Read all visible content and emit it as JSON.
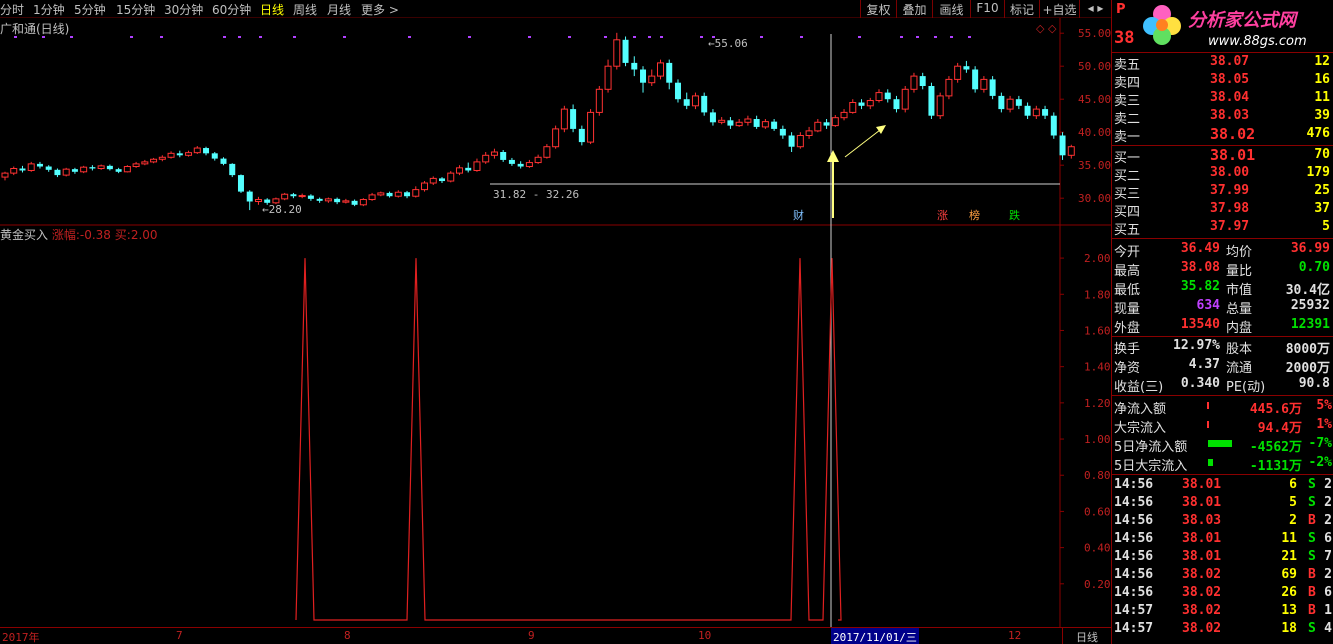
{
  "toolbar": {
    "periods": [
      "分时",
      "1分钟",
      "5分钟",
      "15分钟",
      "30分钟",
      "60分钟",
      "日线",
      "周线",
      "月线",
      "更多 >"
    ],
    "active_period": "日线",
    "right_buttons": [
      "复权",
      "叠加",
      "画线",
      "F10",
      "标记",
      "+自选"
    ]
  },
  "main_pane": {
    "title": "广和通(日线)",
    "annotation_high": "55.06",
    "annotation_low": "28.20",
    "annotation_range": "31.82 - 32.26",
    "markers": [
      {
        "label": "财",
        "color": "#80c0ff"
      },
      {
        "label": "涨",
        "color": "#ff4040"
      },
      {
        "label": "榜",
        "color": "#ffa040"
      },
      {
        "label": "跌",
        "color": "#00e000"
      }
    ],
    "y_ticks": [
      "55.00",
      "50.00",
      "45.00",
      "40.00",
      "35.00",
      "30.00"
    ]
  },
  "indicator_pane": {
    "name": "黄金买入",
    "field1_label": "涨幅:",
    "field1_value": "-0.38",
    "field2_label": "买:",
    "field2_value": "2.00",
    "y_ticks": [
      "2.00",
      "1.80",
      "1.60",
      "1.40",
      "1.20",
      "1.00",
      "0.80",
      "0.60",
      "0.40",
      "0.20"
    ]
  },
  "date_axis": {
    "labels": [
      "2017年",
      "7",
      "8",
      "9",
      "10",
      "12"
    ],
    "highlight": "2017/11/01/三",
    "tab": "日线"
  },
  "quote_panel": {
    "price_big": "38",
    "logo_text": "分析家公式网",
    "logo_url": "www.88gs.com",
    "asks": [
      {
        "label": "卖五",
        "price": "38.07",
        "vol": "12"
      },
      {
        "label": "卖四",
        "price": "38.05",
        "vol": "16"
      },
      {
        "label": "卖三",
        "price": "38.04",
        "vol": "11"
      },
      {
        "label": "卖二",
        "price": "38.03",
        "vol": "39"
      },
      {
        "label": "卖一",
        "price": "38.02",
        "vol": "476"
      }
    ],
    "bids": [
      {
        "label": "买一",
        "price": "38.01",
        "vol": "70"
      },
      {
        "label": "买二",
        "price": "38.00",
        "vol": "179"
      },
      {
        "label": "买三",
        "price": "37.99",
        "vol": "25"
      },
      {
        "label": "买四",
        "price": "37.98",
        "vol": "37"
      },
      {
        "label": "买五",
        "price": "37.97",
        "vol": "5"
      }
    ],
    "stats": [
      {
        "l1": "今开",
        "v1": "36.49",
        "l2": "均价",
        "v2": "36.99"
      },
      {
        "l1": "最高",
        "v1": "38.08",
        "l2": "量比",
        "v2": "0.70"
      },
      {
        "l1": "最低",
        "v1": "35.82",
        "l2": "市值",
        "v2": "30.4亿"
      },
      {
        "l1": "现量",
        "v1": "634",
        "l2": "总量",
        "v2": "25932"
      },
      {
        "l1": "外盘",
        "v1": "13540",
        "l2": "内盘",
        "v2": "12391"
      }
    ],
    "stats2": [
      {
        "l1": "换手",
        "v1": "12.97%",
        "l2": "股本",
        "v2": "8000万"
      },
      {
        "l1": "净资",
        "v1": "4.37",
        "l2": "流通",
        "v2": "2000万"
      },
      {
        "l1": "收益(三)",
        "v1": "0.340",
        "l2": "PE(动)",
        "v2": "90.8"
      }
    ],
    "flows": [
      {
        "label": "净流入额",
        "value": "445.6万",
        "pct": "5%"
      },
      {
        "label": "大宗流入",
        "value": "94.4万",
        "pct": "1%"
      },
      {
        "label": "5日净流入额",
        "value": "-4562万",
        "pct": "-7%"
      },
      {
        "label": "5日大宗流入",
        "value": "-1131万",
        "pct": "-2%"
      }
    ],
    "ticks": [
      {
        "time": "14:56",
        "price": "38.01",
        "vol": "6",
        "side": "S",
        "n": "2"
      },
      {
        "time": "14:56",
        "price": "38.01",
        "vol": "5",
        "side": "S",
        "n": "2"
      },
      {
        "time": "14:56",
        "price": "38.03",
        "vol": "2",
        "side": "B",
        "n": "2"
      },
      {
        "time": "14:56",
        "price": "38.01",
        "vol": "11",
        "side": "S",
        "n": "6"
      },
      {
        "time": "14:56",
        "price": "38.01",
        "vol": "21",
        "side": "S",
        "n": "7"
      },
      {
        "time": "14:56",
        "price": "38.02",
        "vol": "69",
        "side": "B",
        "n": "2"
      },
      {
        "time": "14:56",
        "price": "38.02",
        "vol": "26",
        "side": "B",
        "n": "6"
      },
      {
        "time": "14:57",
        "price": "38.02",
        "vol": "13",
        "side": "B",
        "n": "1"
      },
      {
        "time": "14:57",
        "price": "38.02",
        "vol": "18",
        "side": "S",
        "n": "4"
      }
    ]
  },
  "chart_data": {
    "type": "candlestick",
    "title": "广和通(日线)",
    "ylim": [
      27,
      57
    ],
    "candles": [
      [
        33.2,
        33.8,
        32.7,
        34.0
      ],
      [
        33.8,
        34.5,
        33.5,
        34.8
      ],
      [
        34.5,
        34.2,
        33.9,
        34.9
      ],
      [
        34.2,
        35.2,
        34.0,
        35.5
      ],
      [
        35.2,
        34.8,
        34.5,
        35.5
      ],
      [
        34.8,
        34.3,
        34.0,
        35.0
      ],
      [
        34.3,
        33.5,
        33.2,
        34.5
      ],
      [
        33.5,
        34.4,
        33.3,
        34.6
      ],
      [
        34.4,
        34.0,
        33.7,
        34.6
      ],
      [
        34.0,
        34.7,
        33.8,
        34.9
      ],
      [
        34.7,
        34.5,
        34.2,
        35.0
      ],
      [
        34.5,
        34.9,
        34.3,
        35.1
      ],
      [
        34.9,
        34.4,
        34.2,
        35.1
      ],
      [
        34.4,
        34.0,
        33.8,
        34.6
      ],
      [
        34.0,
        34.8,
        33.9,
        35.0
      ],
      [
        34.8,
        35.2,
        34.6,
        35.5
      ],
      [
        35.2,
        35.5,
        35.0,
        35.8
      ],
      [
        35.5,
        35.9,
        35.3,
        36.1
      ],
      [
        35.9,
        36.2,
        35.6,
        36.5
      ],
      [
        36.2,
        36.8,
        36.0,
        37.1
      ],
      [
        36.8,
        36.5,
        36.2,
        37.2
      ],
      [
        36.5,
        36.9,
        36.3,
        37.2
      ],
      [
        36.9,
        37.6,
        36.7,
        37.9
      ],
      [
        37.6,
        36.8,
        36.5,
        37.8
      ],
      [
        36.8,
        36.0,
        35.7,
        37.0
      ],
      [
        36.0,
        35.2,
        35.0,
        36.2
      ],
      [
        35.2,
        33.5,
        33.2,
        35.3
      ],
      [
        33.5,
        31.0,
        30.8,
        33.6
      ],
      [
        31.0,
        29.5,
        28.2,
        31.2
      ],
      [
        29.5,
        29.8,
        29.0,
        30.2
      ],
      [
        29.8,
        29.3,
        29.0,
        30.0
      ],
      [
        29.3,
        29.9,
        29.1,
        30.1
      ],
      [
        29.9,
        30.6,
        29.7,
        30.8
      ],
      [
        30.6,
        30.3,
        30.0,
        30.8
      ],
      [
        30.3,
        30.4,
        30.0,
        30.7
      ],
      [
        30.4,
        29.9,
        29.6,
        30.6
      ],
      [
        29.9,
        29.6,
        29.3,
        30.1
      ],
      [
        29.6,
        29.9,
        29.3,
        30.1
      ],
      [
        29.9,
        29.4,
        29.1,
        30.1
      ],
      [
        29.4,
        29.6,
        29.2,
        29.9
      ],
      [
        29.6,
        29.0,
        28.8,
        29.8
      ],
      [
        29.0,
        29.8,
        28.8,
        30.0
      ],
      [
        29.8,
        30.5,
        29.6,
        30.8
      ],
      [
        30.5,
        30.8,
        30.3,
        31.0
      ],
      [
        30.8,
        30.3,
        30.1,
        31.0
      ],
      [
        30.3,
        30.9,
        30.1,
        31.2
      ],
      [
        30.9,
        30.3,
        30.0,
        31.1
      ],
      [
        30.3,
        31.3,
        30.1,
        31.8
      ],
      [
        31.3,
        32.3,
        31.0,
        32.6
      ],
      [
        32.3,
        33.0,
        32.0,
        33.3
      ],
      [
        33.0,
        32.6,
        32.3,
        33.2
      ],
      [
        32.6,
        33.8,
        32.4,
        34.1
      ],
      [
        33.8,
        34.6,
        33.5,
        35.0
      ],
      [
        34.6,
        34.2,
        33.9,
        35.4
      ],
      [
        34.2,
        35.5,
        34.0,
        36.0
      ],
      [
        35.5,
        36.5,
        35.2,
        37.0
      ],
      [
        36.5,
        37.0,
        36.0,
        37.5
      ],
      [
        37.0,
        35.8,
        35.5,
        37.3
      ],
      [
        35.8,
        35.2,
        34.9,
        36.1
      ],
      [
        35.2,
        34.8,
        34.5,
        35.6
      ],
      [
        34.8,
        35.4,
        34.6,
        35.8
      ],
      [
        35.4,
        36.2,
        35.2,
        36.6
      ],
      [
        36.2,
        37.8,
        36.0,
        38.2
      ],
      [
        37.8,
        40.5,
        37.5,
        41.0
      ],
      [
        40.5,
        43.5,
        40.0,
        44.0
      ],
      [
        43.5,
        40.5,
        40.0,
        44.2
      ],
      [
        40.5,
        38.5,
        38.0,
        41.0
      ],
      [
        38.5,
        43.0,
        38.2,
        43.5
      ],
      [
        43.0,
        46.5,
        42.5,
        47.0
      ],
      [
        46.5,
        50.0,
        46.0,
        51.0
      ],
      [
        50.0,
        54.0,
        49.5,
        55.06
      ],
      [
        54.0,
        50.5,
        50.0,
        54.5
      ],
      [
        50.5,
        49.5,
        48.5,
        51.5
      ],
      [
        49.5,
        47.5,
        46.0,
        50.0
      ],
      [
        47.5,
        48.5,
        47.0,
        49.5
      ],
      [
        48.5,
        50.5,
        48.0,
        51.0
      ],
      [
        50.5,
        47.5,
        46.5,
        51.0
      ],
      [
        47.5,
        45.0,
        44.5,
        48.0
      ],
      [
        45.0,
        44.0,
        43.5,
        46.0
      ],
      [
        44.0,
        45.5,
        43.5,
        46.0
      ],
      [
        45.5,
        43.0,
        42.5,
        46.0
      ],
      [
        43.0,
        41.5,
        41.0,
        43.5
      ],
      [
        41.5,
        41.8,
        41.2,
        42.3
      ],
      [
        41.8,
        41.0,
        40.5,
        42.3
      ],
      [
        41.0,
        41.5,
        40.8,
        42.0
      ],
      [
        41.5,
        42.0,
        41.0,
        42.5
      ],
      [
        42.0,
        40.8,
        40.5,
        42.5
      ],
      [
        40.8,
        41.6,
        40.5,
        42.0
      ],
      [
        41.6,
        40.5,
        40.2,
        42.0
      ],
      [
        40.5,
        39.5,
        39.0,
        41.0
      ],
      [
        39.5,
        37.8,
        37.0,
        40.0
      ],
      [
        37.8,
        39.5,
        37.5,
        40.0
      ],
      [
        39.5,
        40.2,
        39.0,
        40.8
      ],
      [
        40.2,
        41.5,
        40.0,
        42.0
      ],
      [
        41.5,
        41.0,
        40.5,
        42.0
      ],
      [
        41.0,
        42.2,
        40.8,
        42.6
      ],
      [
        42.2,
        43.0,
        41.8,
        43.5
      ],
      [
        43.0,
        44.5,
        42.8,
        45.0
      ],
      [
        44.5,
        44.0,
        43.5,
        45.0
      ],
      [
        44.0,
        44.8,
        43.5,
        45.2
      ],
      [
        44.8,
        46.0,
        44.5,
        46.5
      ],
      [
        46.0,
        45.0,
        44.5,
        46.5
      ],
      [
        45.0,
        43.5,
        43.0,
        45.5
      ],
      [
        43.5,
        46.5,
        43.0,
        47.0
      ],
      [
        46.5,
        48.5,
        46.0,
        49.0
      ],
      [
        48.5,
        47.0,
        46.5,
        49.0
      ],
      [
        47.0,
        42.5,
        42.0,
        47.5
      ],
      [
        42.5,
        45.5,
        42.0,
        46.0
      ],
      [
        45.5,
        48.0,
        45.0,
        48.5
      ],
      [
        48.0,
        50.0,
        47.5,
        50.5
      ],
      [
        50.0,
        49.5,
        49.0,
        50.8
      ],
      [
        49.5,
        46.5,
        46.0,
        50.0
      ],
      [
        46.5,
        48.0,
        46.0,
        48.5
      ],
      [
        48.0,
        45.5,
        45.0,
        48.5
      ],
      [
        45.5,
        43.5,
        43.0,
        46.0
      ],
      [
        43.5,
        45.0,
        43.0,
        45.5
      ],
      [
        45.0,
        44.0,
        43.5,
        45.5
      ],
      [
        44.0,
        42.5,
        42.0,
        44.5
      ],
      [
        42.5,
        43.5,
        42.0,
        44.0
      ],
      [
        43.5,
        42.5,
        42.0,
        44.0
      ],
      [
        42.5,
        39.5,
        39.0,
        43.0
      ],
      [
        39.5,
        36.5,
        35.8,
        40.0
      ],
      [
        36.5,
        37.8,
        36.0,
        38.1
      ]
    ],
    "indicator": {
      "name": "黄金买入",
      "ylim": [
        0,
        2.1
      ],
      "spike_indices": [
        27,
        40,
        87,
        92
      ],
      "spike_value": 2.0
    }
  }
}
